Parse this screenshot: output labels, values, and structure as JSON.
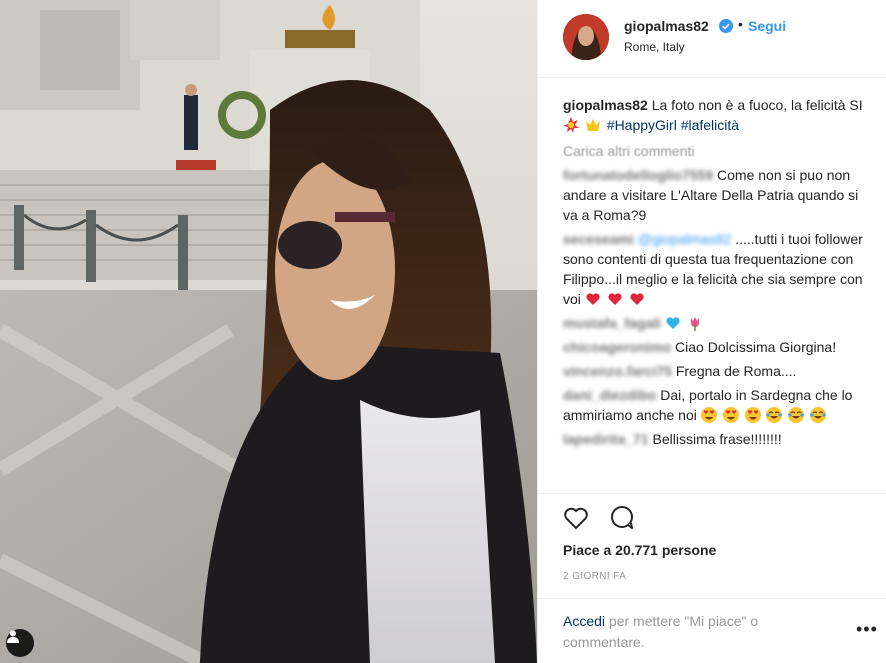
{
  "post": {
    "author": "giopalmas82",
    "follow_label": "Segui",
    "dot": "•",
    "location": "Rome, Italy",
    "caption_text": "La foto non è a fuoco, la felicità SI",
    "hashtags": [
      "#HappyGirl",
      "#lafelicità"
    ],
    "load_more_label": "Carica altri commenti",
    "comments": [
      {
        "user": "fortunatodelloglio7559",
        "text": "Come non si puo non andare a visitare L'Altare Della Patria quando si va a Roma?9"
      },
      {
        "user": "seceseami",
        "mention": "@giopalmas82",
        "text": ".....tutti i tuoi follower sono contenti di questa tua frequentazione con Filippo...il meglio e la felicità che sia sempre con voi"
      },
      {
        "user": "mustafa_fagali",
        "text": ""
      },
      {
        "user": "chicoageronimo",
        "text": "Ciao Dolcissima Giorgina!"
      },
      {
        "user": "vincenzo.farci75",
        "text": "Fregna de Roma...."
      },
      {
        "user": "dani_diezdibo",
        "text": "Dai, portalo in Sardegna che lo ammiriamo anche noi"
      },
      {
        "user": "lapedirita_71",
        "text": "Bellissima frase!!!!!!!!"
      }
    ],
    "likes_label": "Piace a 20.771 persone",
    "time_label": "2 GIORNI FA",
    "login_link": "Accedi",
    "login_text": "per mettere \"Mi piace\" o commentare.",
    "more_label": "•••"
  },
  "colors": {
    "link": "#003569",
    "accent": "#3897f0",
    "heart": "#ed4956"
  },
  "icons": [
    "heart-icon",
    "comment-icon",
    "verified-badge-icon",
    "user-tag-icon",
    "more-options-icon"
  ]
}
